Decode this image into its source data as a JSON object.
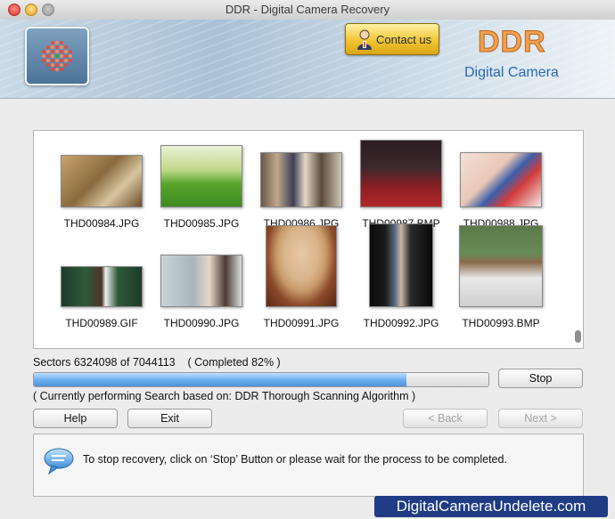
{
  "window": {
    "title": "DDR - Digital Camera Recovery"
  },
  "header": {
    "contact_label": "Contact us",
    "brand": "DDR",
    "brand_sub": "Digital Camera"
  },
  "thumbnails": [
    {
      "name": "THD00984.JPG"
    },
    {
      "name": "THD00985.JPG"
    },
    {
      "name": "THD00986.JPG"
    },
    {
      "name": "THD00987.BMP"
    },
    {
      "name": "THD00988.JPG"
    },
    {
      "name": "THD00989.GIF"
    },
    {
      "name": "THD00990.JPG"
    },
    {
      "name": "THD00991.JPG"
    },
    {
      "name": "THD00992.JPG"
    },
    {
      "name": "THD00993.BMP"
    }
  ],
  "status": {
    "sectors_text": "Sectors 6324098 of 7044113    ( Completed 82% )",
    "progress_fraction": 0.82,
    "algorithm_text": "( Currently performing Search based on: DDR Thorough Scanning Algorithm )"
  },
  "buttons": {
    "stop": "Stop",
    "help": "Help",
    "exit": "Exit",
    "back": "< Back",
    "next": "Next >"
  },
  "info": {
    "message": "To stop recovery, click on ‘Stop’ Button or please wait for the process to be completed."
  },
  "watermark": "DigitalCameraUndelete.com",
  "colors": {
    "progress_fill": "#6fb0f0",
    "watermark_bg": "#1f3c84",
    "contact_button": "#f2c531",
    "brand_orange": "#f0a050",
    "brand_blue": "#2a6ab0"
  },
  "icons": {
    "logo": "ddr-logo-icon",
    "contact": "person-icon",
    "info": "speech-bubble-icon"
  }
}
